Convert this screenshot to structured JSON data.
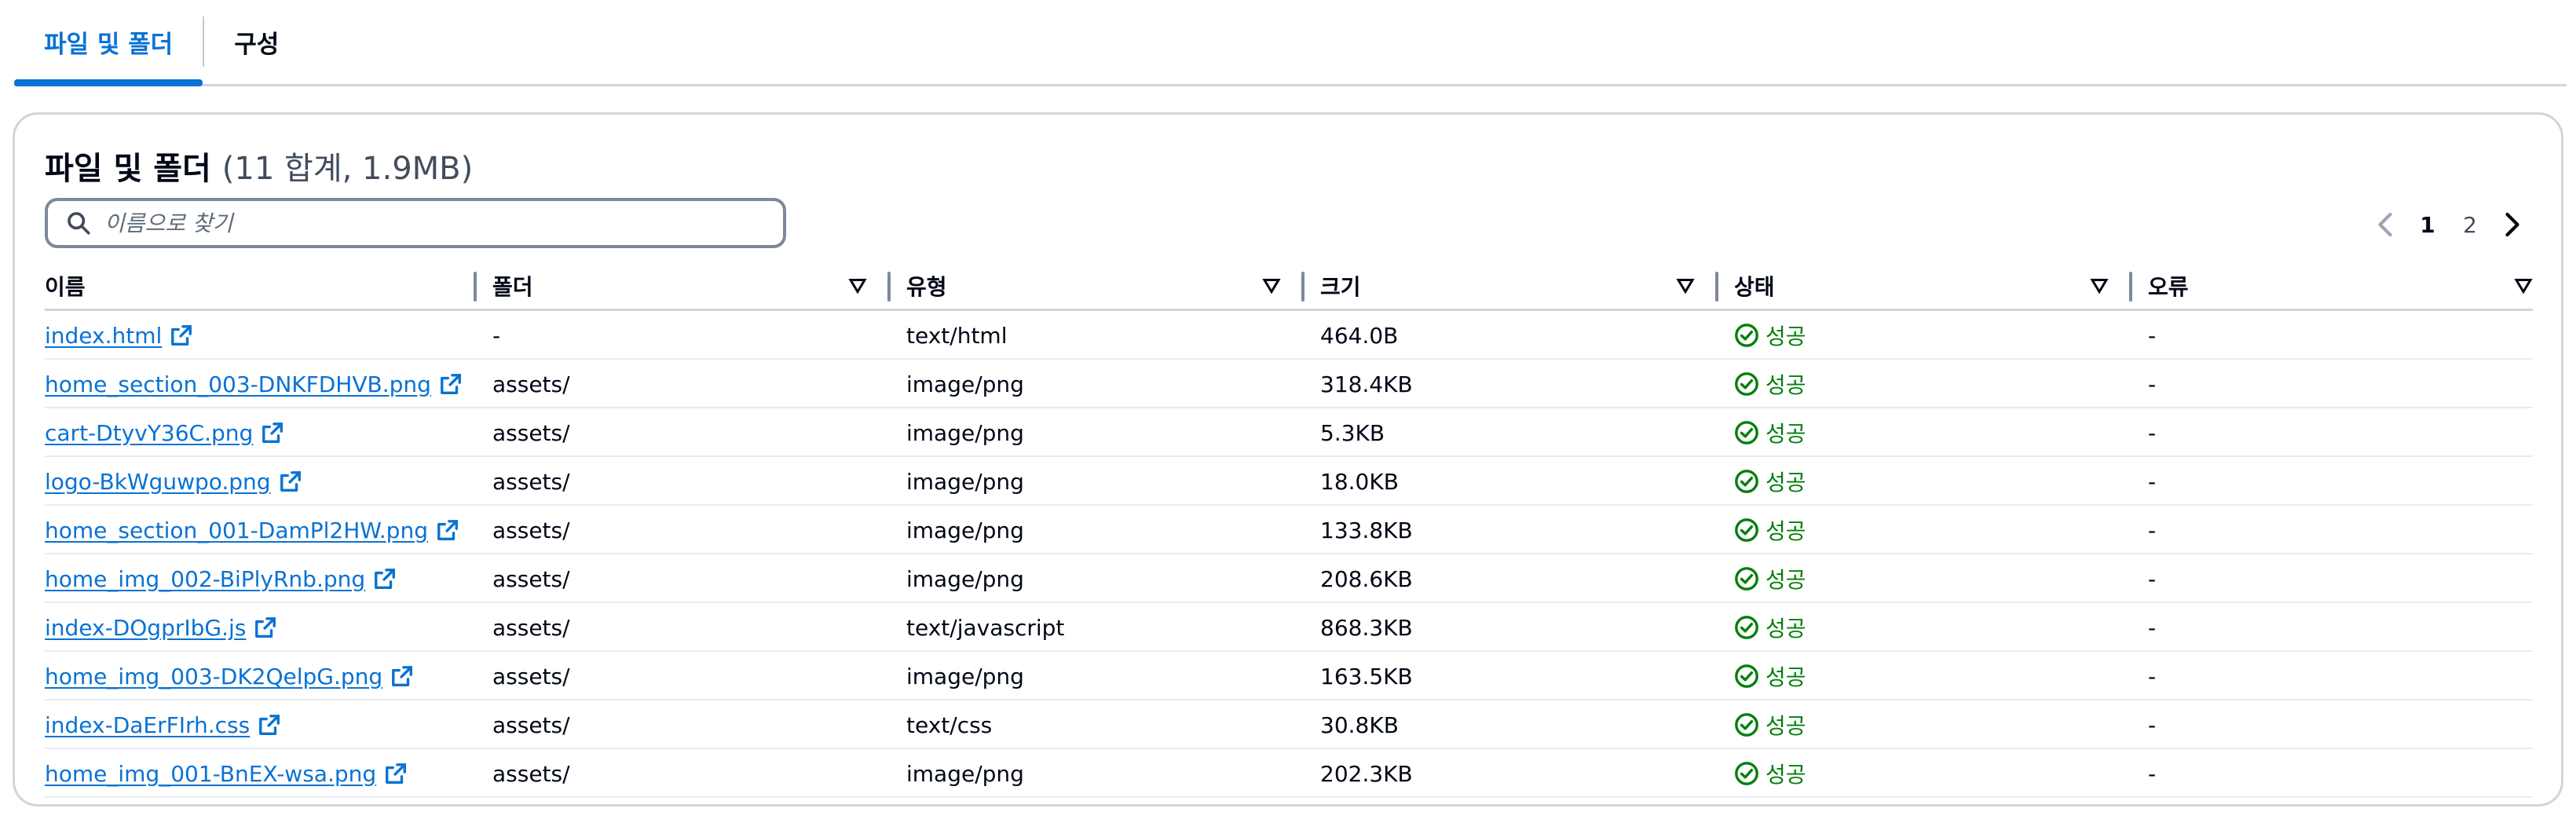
{
  "tabs": [
    {
      "label": "파일 및 폴더",
      "active": true
    },
    {
      "label": "구성",
      "active": false
    }
  ],
  "header": {
    "title": "파일 및 폴더",
    "count": "(11 합계, 1.9MB)"
  },
  "search": {
    "placeholder": "이름으로 찾기"
  },
  "pagination": {
    "pages": [
      "1",
      "2"
    ],
    "current": "1"
  },
  "columns": [
    "이름",
    "폴더",
    "유형",
    "크기",
    "상태",
    "오류"
  ],
  "rows": [
    {
      "name": "index.html",
      "folder": "-",
      "type": "text/html",
      "size": "464.0B",
      "status": "성공",
      "error": "-"
    },
    {
      "name": "home_section_003-DNKFDHVB.png",
      "folder": "assets/",
      "type": "image/png",
      "size": "318.4KB",
      "status": "성공",
      "error": "-"
    },
    {
      "name": "cart-DtyvY36C.png",
      "folder": "assets/",
      "type": "image/png",
      "size": "5.3KB",
      "status": "성공",
      "error": "-"
    },
    {
      "name": "logo-BkWguwpo.png",
      "folder": "assets/",
      "type": "image/png",
      "size": "18.0KB",
      "status": "성공",
      "error": "-"
    },
    {
      "name": "home_section_001-DamPl2HW.png",
      "folder": "assets/",
      "type": "image/png",
      "size": "133.8KB",
      "status": "성공",
      "error": "-"
    },
    {
      "name": "home_img_002-BiPlyRnb.png",
      "folder": "assets/",
      "type": "image/png",
      "size": "208.6KB",
      "status": "성공",
      "error": "-"
    },
    {
      "name": "index-DOgprIbG.js",
      "folder": "assets/",
      "type": "text/javascript",
      "size": "868.3KB",
      "status": "성공",
      "error": "-"
    },
    {
      "name": "home_img_003-DK2QelpG.png",
      "folder": "assets/",
      "type": "image/png",
      "size": "163.5KB",
      "status": "성공",
      "error": "-"
    },
    {
      "name": "index-DaErFIrh.css",
      "folder": "assets/",
      "type": "text/css",
      "size": "30.8KB",
      "status": "성공",
      "error": "-"
    },
    {
      "name": "home_img_001-BnEX-wsa.png",
      "folder": "assets/",
      "type": "image/png",
      "size": "202.3KB",
      "status": "성공",
      "error": "-"
    }
  ],
  "colors": {
    "accent": "#0972d3",
    "success": "#037f0c",
    "border": "#d1d5db"
  }
}
